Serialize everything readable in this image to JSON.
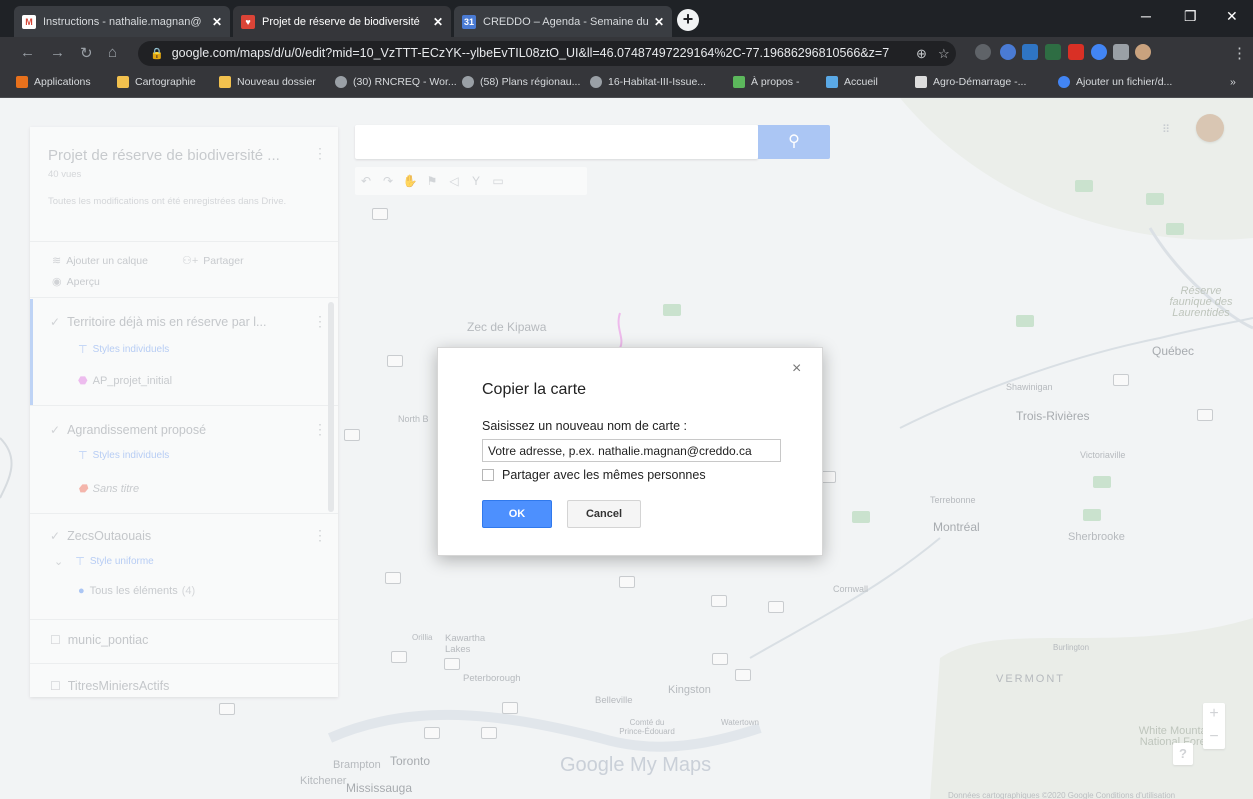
{
  "browser": {
    "tabs": [
      {
        "title": "Instructions - nathalie.magnan@",
        "favicon_color": "#d44638",
        "glyph": "M",
        "active": false
      },
      {
        "title": "Projet de réserve de biodiversité",
        "favicon_color": "#db4437",
        "glyph": "♥",
        "active": true
      },
      {
        "title": "CREDDO – Agenda - Semaine du",
        "favicon_color": "#4a7bd4",
        "glyph": "31",
        "active": false
      }
    ],
    "new_tab": "+",
    "url": "google.com/maps/d/u/0/edit?mid=10_VzTTT-ECzYK--ylbeEvTIL08ztO_UI&ll=46.07487497229164%2C-77.19686296810566&z=7",
    "bookmarks": [
      {
        "label": "Applications",
        "color": "#e8711c"
      },
      {
        "label": "Cartographie",
        "color": "#f2c14e"
      },
      {
        "label": "Nouveau dossier",
        "color": "#f2c14e"
      },
      {
        "label": "(30) RNCREQ - Wor...",
        "color": "#9aa0a6"
      },
      {
        "label": "(58) Plans régionau...",
        "color": "#9aa0a6"
      },
      {
        "label": "16-Habitat-III-Issue...",
        "color": "#9aa0a6"
      },
      {
        "label": "À propos -",
        "color": "#5cb85c"
      },
      {
        "label": "Accueil",
        "color": "#5aa9e6"
      },
      {
        "label": "Agro-Démarrage -...",
        "color": "#dddddd"
      },
      {
        "label": "Ajouter un fichier/d...",
        "color": "#4285f4"
      }
    ],
    "bookmarks_more": "»"
  },
  "map": {
    "labels": [
      {
        "text": "Zec de Kipawa"
      },
      {
        "text": "Québec"
      },
      {
        "text": "Trois-Rivières"
      },
      {
        "text": "Montréal"
      },
      {
        "text": "Sherbrooke"
      },
      {
        "text": "Cornwall"
      },
      {
        "text": "Kingston"
      },
      {
        "text": "Belleville"
      },
      {
        "text": "Peterborough"
      },
      {
        "text": "Kawartha Lakes"
      },
      {
        "text": "Toronto"
      },
      {
        "text": "Brampton"
      },
      {
        "text": "Mississauga"
      },
      {
        "text": "Kitchener"
      },
      {
        "text": "VERMONT"
      },
      {
        "text": "White Mountain National Forest"
      },
      {
        "text": "Shawinigan"
      },
      {
        "text": "Victoriaville"
      },
      {
        "text": "Terrebonne"
      },
      {
        "text": "Réserve faunique des Laurentides"
      },
      {
        "text": "Watertown"
      },
      {
        "text": "Comté du Prince-Édouard"
      },
      {
        "text": "Burlington"
      },
      {
        "text": "Orillia"
      },
      {
        "text": "North B"
      }
    ],
    "logo": "Google My Maps",
    "attribution": "Données cartographiques ©2020 Google   Conditions d'utilisation",
    "zoom_in": "+",
    "zoom_out": "−",
    "help": "?"
  },
  "panel": {
    "title": "Projet de réserve de biodiversité ...",
    "views": "40 vues",
    "saved": "Toutes les modifications ont été enregistrées dans Drive.",
    "add_layer": "Ajouter un calque",
    "share": "Partager",
    "preview": "Aperçu",
    "layers": [
      {
        "name": "Territoire déjà mis en réserve par l...",
        "style": "Styles individuels",
        "item": "AP_projet_initial",
        "item_color": "#e7a6e9"
      },
      {
        "name": "Agrandissement proposé",
        "style": "Styles individuels",
        "item": "Sans titre",
        "item_color": "#f09c8f"
      },
      {
        "name": "ZecsOutaouais",
        "style": "Style uniforme",
        "item": "Tous les éléments",
        "item_count": "(4)",
        "item_color": "#8fb3f0"
      },
      {
        "name": "munic_pontiac"
      },
      {
        "name": "TitresMiniersActifs"
      }
    ]
  },
  "dialog": {
    "title": "Copier la carte",
    "close": "×",
    "label": "Saisissez un nouveau nom de carte :",
    "input_value": "Votre adresse, p.ex. nathalie.magnan@creddo.ca",
    "share_label": "Partager avec les mêmes personnes",
    "ok": "OK",
    "cancel": "Cancel"
  },
  "accent": "#4d90fe"
}
